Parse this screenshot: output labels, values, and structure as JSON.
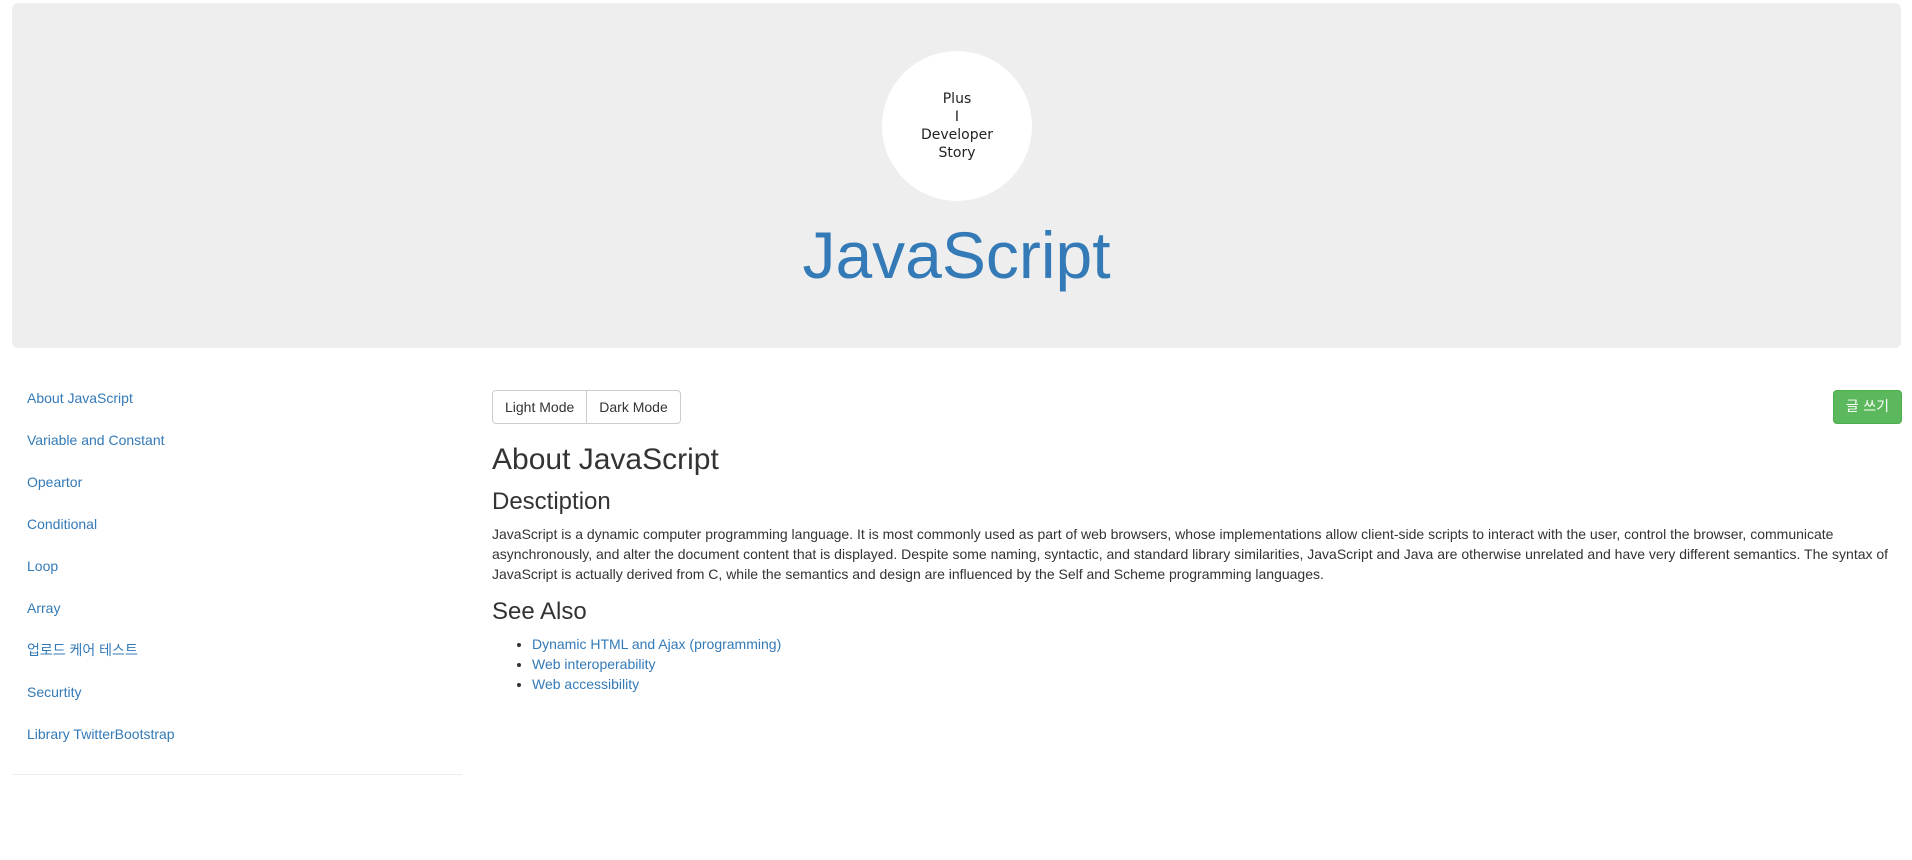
{
  "header": {
    "logo_text": "Plus\nI\nDeveloper\nStory",
    "title": "JavaScript"
  },
  "sidebar": {
    "items": [
      {
        "label": "About JavaScript"
      },
      {
        "label": "Variable and Constant"
      },
      {
        "label": "Opeartor"
      },
      {
        "label": "Conditional"
      },
      {
        "label": "Loop"
      },
      {
        "label": "Array"
      },
      {
        "label": "업로드 케어 테스트"
      },
      {
        "label": "Securtity"
      },
      {
        "label": "Library TwitterBootstrap"
      }
    ]
  },
  "toolbar": {
    "light_mode_label": "Light Mode",
    "dark_mode_label": "Dark Mode",
    "write_label": "글 쓰기"
  },
  "article": {
    "title": "About JavaScript",
    "description_heading": "Desctiption",
    "description": "JavaScript is a dynamic computer programming language. It is most commonly used as part of web browsers, whose implementations allow client-side scripts to interact with the user, control the browser, communicate asynchronously, and alter the document content that is displayed. Despite some naming, syntactic, and standard library similarities, JavaScript and Java are otherwise unrelated and have very different semantics. The syntax of JavaScript is actually derived from C, while the semantics and design are influenced by the Self and Scheme programming languages.",
    "see_also_heading": "See Also",
    "see_also": [
      {
        "label": "Dynamic HTML and Ajax (programming)"
      },
      {
        "label": "Web interoperability"
      },
      {
        "label": "Web accessibility"
      }
    ]
  },
  "colors": {
    "link": "#337ab7",
    "jumbotron_bg": "#eeeeee",
    "success": "#5cb85c"
  }
}
